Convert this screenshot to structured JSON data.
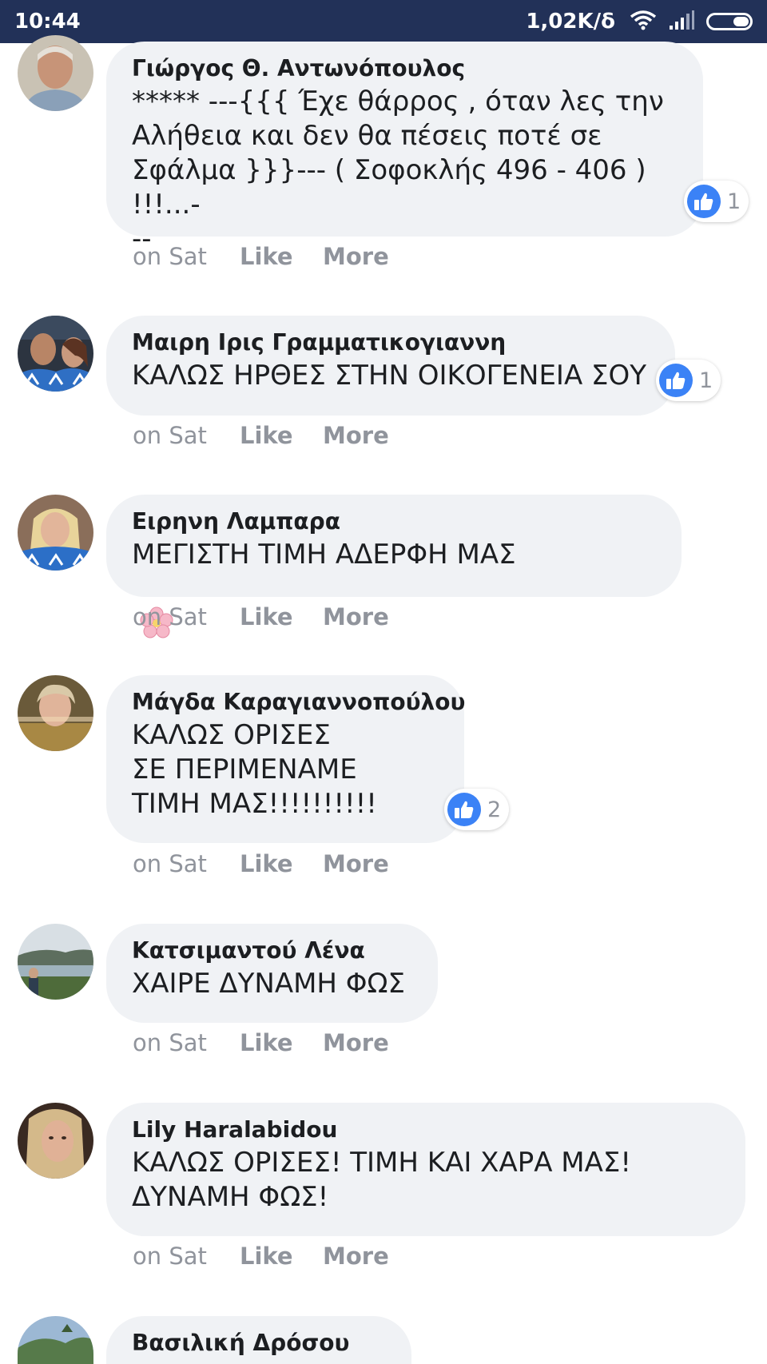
{
  "status_bar": {
    "time": "10:44",
    "speed": "1,02K/δ",
    "wifi_icon": "wifi-icon",
    "signal_icon": "signal-icon",
    "battery_icon": "battery-icon",
    "battery_level": 0.4,
    "background_color": "#223158"
  },
  "action_labels": {
    "time": "on Sat",
    "like": "Like",
    "more": "More"
  },
  "colors": {
    "bubble": "#f0f2f5",
    "like_badge": "#3b82f6",
    "muted_text": "#90949c"
  },
  "comments": [
    {
      "author": "Γιώργος Θ. Αντωνόπουλος",
      "text": "***** ---{{{ Έχε θάρρος , όταν λες την\nΑλήθεια και δεν θα πέσεις ποτέ σε\nΣφάλμα }}}--- ( Σοφοκλής 496 - 406 ) !!!...-\n--",
      "reactions": "1"
    },
    {
      "author": "Μαιρη Ιρις Γραμματικογιαννη",
      "text": "ΚΑΛΩΣ ΗΡΘΕΣ ΣΤΗΝ ΟΙΚΟΓΕΝΕΙΑ ΣΟΥ",
      "reactions": "1"
    },
    {
      "author": "Ειρηνη Λαμπαρα",
      "text": "ΜΕΓΙΣΤΗ ΤΙΜΗ ΑΔΕΡΦΗ ΜΑΣ",
      "emojis": [
        "cherry-blossom-icon",
        "rose-icon",
        "cherry-blossom-icon"
      ]
    },
    {
      "author": "Μάγδα Καραγιαννοπούλου",
      "text": "ΚΑΛΩΣ ΟΡΙΣΕΣ\nΣΕ ΠΕΡΙΜΕΝΑΜΕ\nΤΙΜΗ ΜΑΣ!!!!!!!!!!",
      "reactions": "2"
    },
    {
      "author": "Κατσιμαντού Λένα",
      "text": "ΧΑΙΡΕ ΔΥΝΑΜΗ ΦΩΣ"
    },
    {
      "author": "Lily Haralabidou",
      "text": "ΚΑΛΩΣ ΟΡΙΣΕΣ! ΤΙΜΗ ΚΑΙ ΧΑΡΑ ΜΑΣ!\nΔΥΝΑΜΗ ΦΩΣ!"
    },
    {
      "author": "Βασιλική Δρόσου",
      "text": ""
    }
  ]
}
